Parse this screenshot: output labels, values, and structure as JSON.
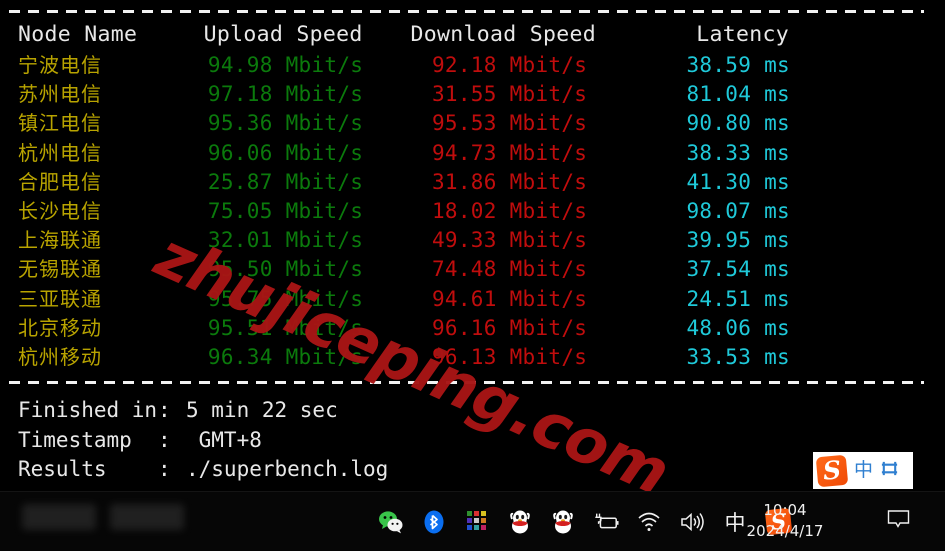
{
  "terminal": {
    "headers": {
      "node": "Node Name",
      "upload": "Upload Speed",
      "download": "Download Speed",
      "latency": "Latency"
    },
    "rows": [
      {
        "node": "宁波电信",
        "upload": "94.98 Mbit/s",
        "download": "92.18 Mbit/s",
        "latency": "38.59 ms"
      },
      {
        "node": "苏州电信",
        "upload": "97.18 Mbit/s",
        "download": "31.55 Mbit/s",
        "latency": "81.04 ms"
      },
      {
        "node": "镇江电信",
        "upload": "95.36 Mbit/s",
        "download": "95.53 Mbit/s",
        "latency": "90.80 ms"
      },
      {
        "node": "杭州电信",
        "upload": "96.06 Mbit/s",
        "download": "94.73 Mbit/s",
        "latency": "38.33 ms"
      },
      {
        "node": "合肥电信",
        "upload": "25.87 Mbit/s",
        "download": "31.86 Mbit/s",
        "latency": "41.30 ms"
      },
      {
        "node": "长沙电信",
        "upload": "75.05 Mbit/s",
        "download": "18.02 Mbit/s",
        "latency": "98.07 ms"
      },
      {
        "node": "上海联通",
        "upload": "32.01 Mbit/s",
        "download": "49.33 Mbit/s",
        "latency": "39.95 ms"
      },
      {
        "node": "无锡联通",
        "upload": "95.50 Mbit/s",
        "download": "74.48 Mbit/s",
        "latency": "37.54 ms"
      },
      {
        "node": "三亚联通",
        "upload": "95.75 Mbit/s",
        "download": "94.61 Mbit/s",
        "latency": "24.51 ms"
      },
      {
        "node": "北京移动",
        "upload": "95.51 Mbit/s",
        "download": "96.16 Mbit/s",
        "latency": "48.06 ms"
      },
      {
        "node": "杭州移动",
        "upload": "96.34 Mbit/s",
        "download": "96.13 Mbit/s",
        "latency": "33.53 ms"
      }
    ],
    "summary": [
      {
        "key": "Finished in",
        "colon": ":",
        "value": "5 min 22 sec"
      },
      {
        "key": "Timestamp",
        "colon": ":",
        "value": " GMT+8"
      },
      {
        "key": "Results",
        "colon": ":",
        "value": "./superbench.log"
      }
    ],
    "colors": {
      "node": "#b9a400",
      "upload": "#0b7a0c",
      "download": "#c00d0d",
      "latency": "#1fc9d9",
      "header_text": "#e8e8e8",
      "background": "#000000"
    }
  },
  "watermark": {
    "text": "zhujiceping.com",
    "color": "#a81515"
  },
  "ime_bar": {
    "logo_letter": "S",
    "mode_glyph": "中",
    "panel_glyph": "口"
  },
  "taskbar": {
    "tray_icons": [
      {
        "name": "wechat-icon",
        "glyph": ""
      },
      {
        "name": "bluetooth-icon",
        "glyph": ""
      },
      {
        "name": "color-grid-icon",
        "glyph": ""
      },
      {
        "name": "qq-icon-1",
        "glyph": ""
      },
      {
        "name": "qq-icon-2",
        "glyph": ""
      },
      {
        "name": "battery-icon",
        "glyph": ""
      },
      {
        "name": "wifi-icon",
        "glyph": ""
      },
      {
        "name": "volume-icon",
        "glyph": ""
      },
      {
        "name": "ime-chinese-icon",
        "glyph": "中"
      },
      {
        "name": "sogou-icon",
        "glyph": "S"
      }
    ],
    "clock": {
      "time": "10:04",
      "date": "2024/4/17"
    }
  }
}
